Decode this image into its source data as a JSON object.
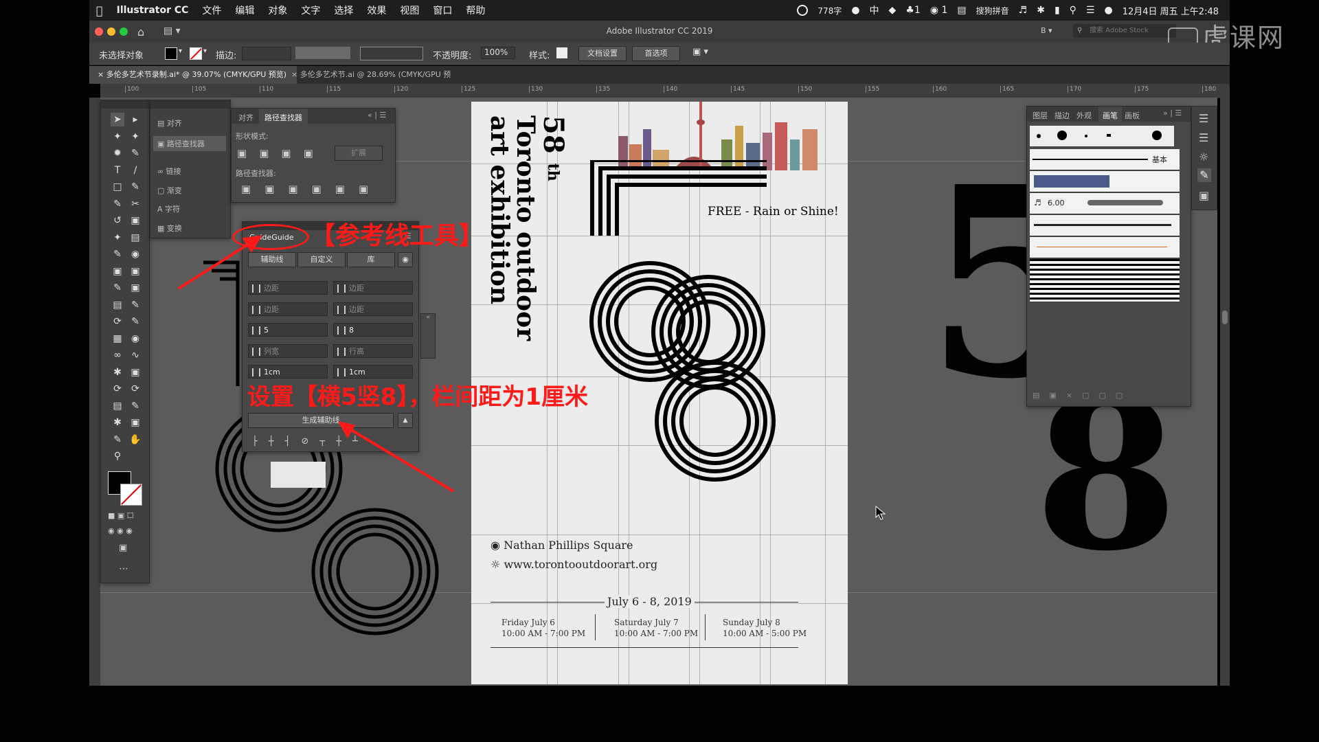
{
  "menubar": {
    "app": "Illustrator CC",
    "items": [
      "文件",
      "编辑",
      "对象",
      "文字",
      "选择",
      "效果",
      "视图",
      "窗口",
      "帮助"
    ],
    "word_count": "778字",
    "ime": "中",
    "notif": "1",
    "wechat": "1",
    "sogou": "搜狗拼音",
    "clock": "12月4日 周五 上午2:48"
  },
  "appbar": {
    "title": "Adobe Illustrator CC 2019",
    "workspace": "B",
    "search_placeholder": "搜索 Adobe Stock"
  },
  "watermark": "虎课网",
  "control": {
    "selection": "未选择对象",
    "stroke_label": "描边:",
    "opacity_label": "不透明度:",
    "opacity_value": "100%",
    "style_label": "样式:",
    "doc_setup": "文档设置",
    "prefs": "首选项"
  },
  "tabs": [
    {
      "label": "多伦多艺术节录制.ai* @ 39.07% (CMYK/GPU 预览)"
    },
    {
      "label": "多伦多艺术节.ai @ 28.69% (CMYK/GPU 预览)"
    }
  ],
  "ruler_ticks": [
    "100",
    "105",
    "110",
    "115",
    "120",
    "125",
    "130",
    "135",
    "140",
    "145",
    "150",
    "155",
    "160",
    "165",
    "170",
    "175",
    "180"
  ],
  "left_panel": {
    "items": [
      "对齐",
      "路径查找器",
      "链接",
      "渐变",
      "字符",
      "变换"
    ]
  },
  "pathfinder": {
    "tabs": [
      "对齐",
      "路径查找器"
    ],
    "shape_modes": "形状模式:",
    "expand": "扩展",
    "pathfinders": "路径查找器:"
  },
  "guideguide": {
    "title": "GuideGuide",
    "tabs": [
      "辅助线",
      "自定义",
      "库"
    ],
    "fields": [
      {
        "value": "",
        "placeholder": "边距"
      },
      {
        "value": "",
        "placeholder": "边距"
      },
      {
        "value": "",
        "placeholder": "边距"
      },
      {
        "value": "",
        "placeholder": "边距"
      },
      {
        "value": "5",
        "placeholder": ""
      },
      {
        "value": "8",
        "placeholder": ""
      },
      {
        "value": "",
        "placeholder": "列宽"
      },
      {
        "value": "",
        "placeholder": "行高"
      },
      {
        "value": "1cm",
        "placeholder": ""
      },
      {
        "value": "1cm",
        "placeholder": ""
      }
    ],
    "generate": "生成辅助线"
  },
  "annotations": {
    "tool": "【参考线工具】",
    "settings": "设置【横5竖8】，栏间距为1厘米"
  },
  "poster": {
    "title_num": "58",
    "title_sup": "th",
    "title_line1": "Toronto outdoor",
    "title_line2": "art exhibition",
    "free": "FREE - Rain or Shine!",
    "location": "Nathan Phillips Square",
    "url": "www.torontooutdoorart.org",
    "dates": "July 6 - 8, 2019",
    "days": [
      {
        "day": "Friday July 6",
        "time": "10:00 AM - 7:00 PM"
      },
      {
        "day": "Saturday July 7",
        "time": "10:00 AM - 7:00 PM"
      },
      {
        "day": "Sunday July 8",
        "time": "10:00 AM - 5:00 PM"
      }
    ]
  },
  "brushes": {
    "tabs": [
      "图层",
      "描边",
      "外观",
      "画笔",
      "画板"
    ],
    "basic": "基本",
    "size": "6.00"
  },
  "colors": {
    "annotation": "#ff1a1a",
    "panel": "#484848",
    "canvas": "#5b5b5b",
    "artboard": "#ececec"
  }
}
